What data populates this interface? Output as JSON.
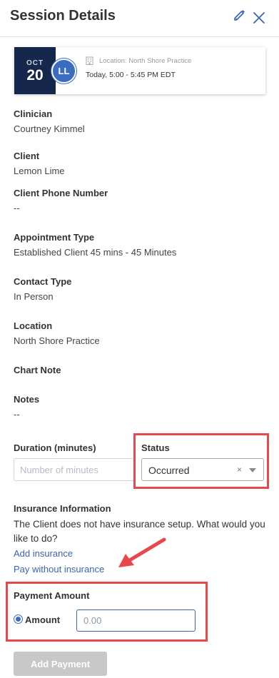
{
  "header": {
    "title": "Session Details"
  },
  "icons": {
    "edit": "pencil-icon",
    "close": "close-icon",
    "location": "building-icon"
  },
  "colors": {
    "accent": "#3a63b8",
    "date_block": "#15284b",
    "highlight": "#e8474c",
    "button_disabled": "#c8c8c8"
  },
  "appointment_card": {
    "month": "OCT",
    "day": "20",
    "avatar_initials": "LL",
    "location": "Location: North Shore Practice",
    "time": "Today, 5:00 - 5:45 PM EDT"
  },
  "fields": {
    "clinician": {
      "label": "Clinician",
      "value": "Courtney Kimmel"
    },
    "client": {
      "label": "Client",
      "value": "Lemon Lime"
    },
    "client_phone": {
      "label": "Client Phone Number",
      "value": "--"
    },
    "appointment_type": {
      "label": "Appointment Type",
      "value": "Established Client 45 mins - 45 Minutes"
    },
    "contact_type": {
      "label": "Contact Type",
      "value": "In Person"
    },
    "location": {
      "label": "Location",
      "value": "North Shore Practice"
    },
    "chart_note": {
      "label": "Chart Note"
    },
    "notes": {
      "label": "Notes",
      "value": "--"
    }
  },
  "duration": {
    "label": "Duration (minutes)",
    "placeholder": "Number of minutes",
    "value": ""
  },
  "status": {
    "label": "Status",
    "selected": "Occurred",
    "clear": "×"
  },
  "insurance": {
    "label": "Insurance Information",
    "message": "The Client does not have insurance setup. What would you like to do?",
    "add_link": "Add insurance",
    "pay_without_link": "Pay without insurance"
  },
  "payment": {
    "label": "Payment Amount",
    "option_label": "Amount",
    "amount_placeholder": "0.00",
    "button": "Add Payment"
  }
}
